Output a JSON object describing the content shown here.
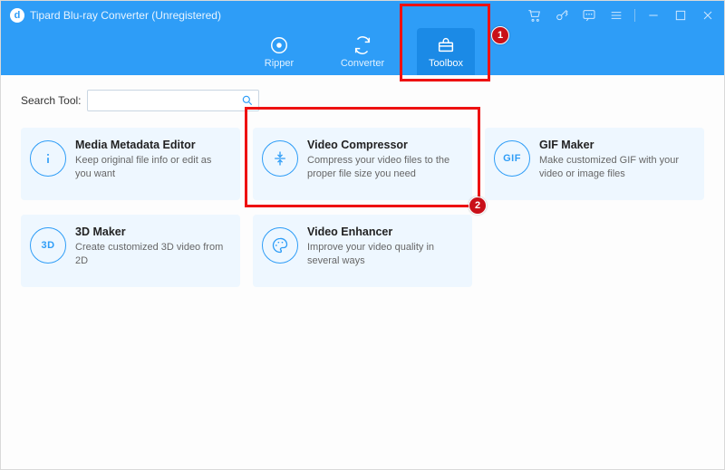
{
  "app": {
    "title": "Tipard Blu-ray Converter (Unregistered)"
  },
  "tabs": {
    "ripper": "Ripper",
    "converter": "Converter",
    "toolbox": "Toolbox"
  },
  "search": {
    "label": "Search Tool:",
    "placeholder": ""
  },
  "tools": {
    "metadata": {
      "title": "Media Metadata Editor",
      "desc": "Keep original file info or edit as you want"
    },
    "compressor": {
      "title": "Video Compressor",
      "desc": "Compress your video files to the proper file size you need"
    },
    "gif": {
      "title": "GIF Maker",
      "desc": "Make customized GIF with your video or image files",
      "icon_text": "GIF"
    },
    "maker3d": {
      "title": "3D Maker",
      "desc": "Create customized 3D video from 2D",
      "icon_text": "3D"
    },
    "enhancer": {
      "title": "Video Enhancer",
      "desc": "Improve your video quality in several ways"
    }
  },
  "annotations": {
    "step1": "1",
    "step2": "2"
  }
}
